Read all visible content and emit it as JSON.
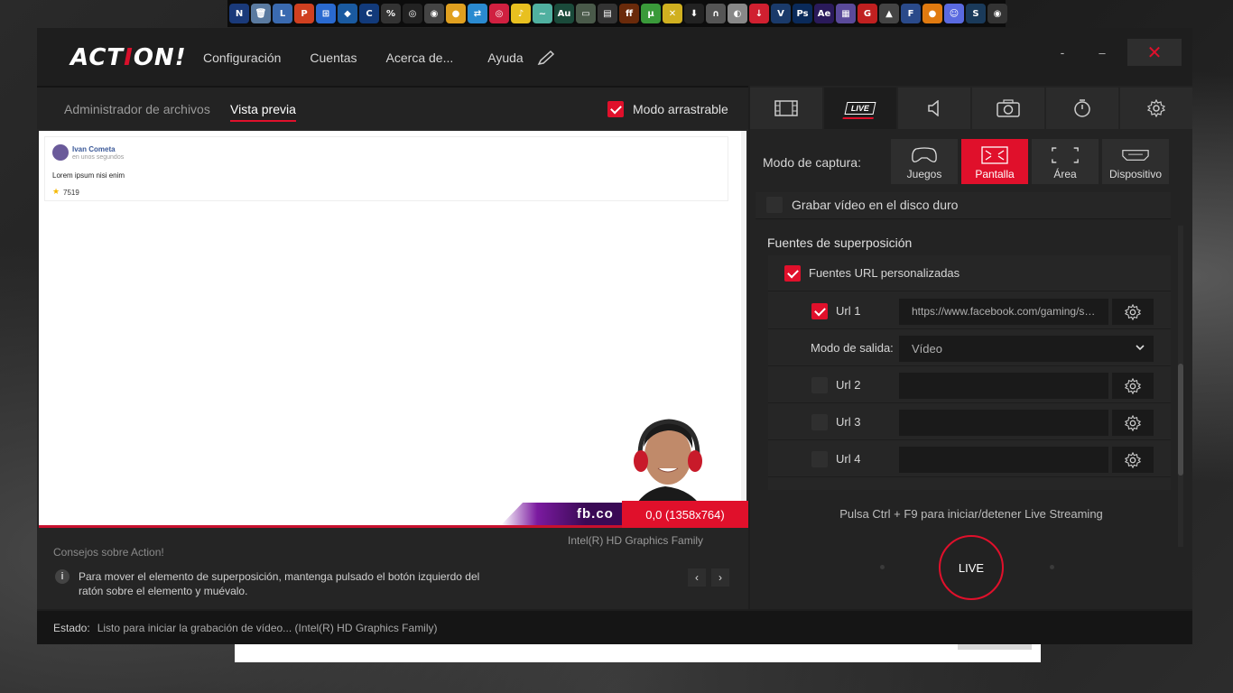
{
  "app": {
    "logo_main": "ACT",
    "logo_red": "I",
    "logo_tail": "ON!",
    "menu": [
      "Configuración",
      "Cuentas",
      "Acerca de...",
      "Ayuda"
    ],
    "close_glyph": "✕",
    "min_glyph": "–",
    "dot_glyph": "-"
  },
  "left": {
    "tabs": [
      "Administrador de archivos",
      "Vista previa"
    ],
    "active_tab": "Vista previa",
    "drag_mode_label": "Modo arrastrable",
    "drag_mode_checked": true,
    "preview": {
      "post_name": "Ivan Cometa",
      "post_time": "en unos segundos",
      "post_text": "Lorem ipsum nisi enim",
      "post_count": "7519",
      "banner_text": "fb.co",
      "resolution": "0,0 (1358x764)"
    },
    "gpu": "Intel(R) HD Graphics Family",
    "tips_title": "Consejos sobre Action!",
    "tip_text": "Para mover el elemento de superposición, mantenga pulsado el botón izquierdo del ratón sobre el elemento y muévalo.",
    "tip_prev": "‹",
    "tip_next": "›"
  },
  "right": {
    "live_tab_label": "LIVE",
    "capture_label": "Modo de captura:",
    "capture_modes": [
      "Juegos",
      "Pantalla",
      "Área",
      "Dispositivo"
    ],
    "active_capture": "Pantalla",
    "record_label": "Grabar vídeo en el disco duro",
    "overlay_title": "Fuentes de superposición",
    "custom_url_label": "Fuentes URL personalizadas",
    "url1_label": "Url 1",
    "url1_value": "https://www.facebook.com/gaming/streamer/",
    "output_mode_label": "Modo de salida:",
    "output_mode_value": "Vídeo",
    "url2_label": "Url 2",
    "url3_label": "Url 3",
    "url4_label": "Url 4",
    "hint": "Pulsa Ctrl + F9 para iniciar/detener Live Streaming",
    "live_button": "LIVE"
  },
  "status": {
    "label": "Estado:",
    "value": "Listo para iniciar la grabación de vídeo... (Intel(R) HD Graphics Family)"
  },
  "colors": {
    "accent": "#e0102b",
    "panel": "#232323",
    "background": "#1e1e1e"
  }
}
